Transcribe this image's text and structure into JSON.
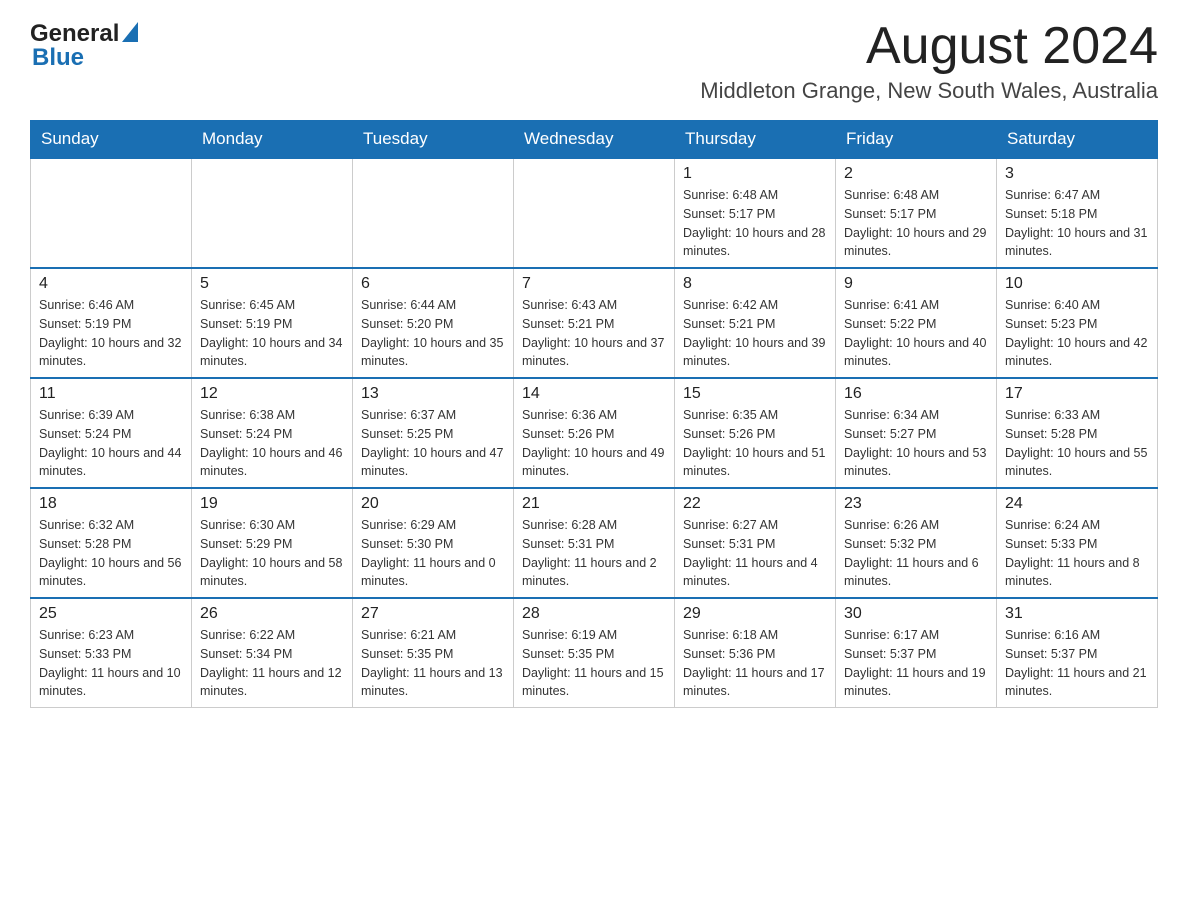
{
  "header": {
    "logo_general": "General",
    "logo_blue": "Blue",
    "month_year": "August 2024",
    "location": "Middleton Grange, New South Wales, Australia"
  },
  "weekdays": [
    "Sunday",
    "Monday",
    "Tuesday",
    "Wednesday",
    "Thursday",
    "Friday",
    "Saturday"
  ],
  "weeks": [
    {
      "days": [
        {
          "date": "",
          "info": ""
        },
        {
          "date": "",
          "info": ""
        },
        {
          "date": "",
          "info": ""
        },
        {
          "date": "",
          "info": ""
        },
        {
          "date": "1",
          "info": "Sunrise: 6:48 AM\nSunset: 5:17 PM\nDaylight: 10 hours and 28 minutes."
        },
        {
          "date": "2",
          "info": "Sunrise: 6:48 AM\nSunset: 5:17 PM\nDaylight: 10 hours and 29 minutes."
        },
        {
          "date": "3",
          "info": "Sunrise: 6:47 AM\nSunset: 5:18 PM\nDaylight: 10 hours and 31 minutes."
        }
      ]
    },
    {
      "days": [
        {
          "date": "4",
          "info": "Sunrise: 6:46 AM\nSunset: 5:19 PM\nDaylight: 10 hours and 32 minutes."
        },
        {
          "date": "5",
          "info": "Sunrise: 6:45 AM\nSunset: 5:19 PM\nDaylight: 10 hours and 34 minutes."
        },
        {
          "date": "6",
          "info": "Sunrise: 6:44 AM\nSunset: 5:20 PM\nDaylight: 10 hours and 35 minutes."
        },
        {
          "date": "7",
          "info": "Sunrise: 6:43 AM\nSunset: 5:21 PM\nDaylight: 10 hours and 37 minutes."
        },
        {
          "date": "8",
          "info": "Sunrise: 6:42 AM\nSunset: 5:21 PM\nDaylight: 10 hours and 39 minutes."
        },
        {
          "date": "9",
          "info": "Sunrise: 6:41 AM\nSunset: 5:22 PM\nDaylight: 10 hours and 40 minutes."
        },
        {
          "date": "10",
          "info": "Sunrise: 6:40 AM\nSunset: 5:23 PM\nDaylight: 10 hours and 42 minutes."
        }
      ]
    },
    {
      "days": [
        {
          "date": "11",
          "info": "Sunrise: 6:39 AM\nSunset: 5:24 PM\nDaylight: 10 hours and 44 minutes."
        },
        {
          "date": "12",
          "info": "Sunrise: 6:38 AM\nSunset: 5:24 PM\nDaylight: 10 hours and 46 minutes."
        },
        {
          "date": "13",
          "info": "Sunrise: 6:37 AM\nSunset: 5:25 PM\nDaylight: 10 hours and 47 minutes."
        },
        {
          "date": "14",
          "info": "Sunrise: 6:36 AM\nSunset: 5:26 PM\nDaylight: 10 hours and 49 minutes."
        },
        {
          "date": "15",
          "info": "Sunrise: 6:35 AM\nSunset: 5:26 PM\nDaylight: 10 hours and 51 minutes."
        },
        {
          "date": "16",
          "info": "Sunrise: 6:34 AM\nSunset: 5:27 PM\nDaylight: 10 hours and 53 minutes."
        },
        {
          "date": "17",
          "info": "Sunrise: 6:33 AM\nSunset: 5:28 PM\nDaylight: 10 hours and 55 minutes."
        }
      ]
    },
    {
      "days": [
        {
          "date": "18",
          "info": "Sunrise: 6:32 AM\nSunset: 5:28 PM\nDaylight: 10 hours and 56 minutes."
        },
        {
          "date": "19",
          "info": "Sunrise: 6:30 AM\nSunset: 5:29 PM\nDaylight: 10 hours and 58 minutes."
        },
        {
          "date": "20",
          "info": "Sunrise: 6:29 AM\nSunset: 5:30 PM\nDaylight: 11 hours and 0 minutes."
        },
        {
          "date": "21",
          "info": "Sunrise: 6:28 AM\nSunset: 5:31 PM\nDaylight: 11 hours and 2 minutes."
        },
        {
          "date": "22",
          "info": "Sunrise: 6:27 AM\nSunset: 5:31 PM\nDaylight: 11 hours and 4 minutes."
        },
        {
          "date": "23",
          "info": "Sunrise: 6:26 AM\nSunset: 5:32 PM\nDaylight: 11 hours and 6 minutes."
        },
        {
          "date": "24",
          "info": "Sunrise: 6:24 AM\nSunset: 5:33 PM\nDaylight: 11 hours and 8 minutes."
        }
      ]
    },
    {
      "days": [
        {
          "date": "25",
          "info": "Sunrise: 6:23 AM\nSunset: 5:33 PM\nDaylight: 11 hours and 10 minutes."
        },
        {
          "date": "26",
          "info": "Sunrise: 6:22 AM\nSunset: 5:34 PM\nDaylight: 11 hours and 12 minutes."
        },
        {
          "date": "27",
          "info": "Sunrise: 6:21 AM\nSunset: 5:35 PM\nDaylight: 11 hours and 13 minutes."
        },
        {
          "date": "28",
          "info": "Sunrise: 6:19 AM\nSunset: 5:35 PM\nDaylight: 11 hours and 15 minutes."
        },
        {
          "date": "29",
          "info": "Sunrise: 6:18 AM\nSunset: 5:36 PM\nDaylight: 11 hours and 17 minutes."
        },
        {
          "date": "30",
          "info": "Sunrise: 6:17 AM\nSunset: 5:37 PM\nDaylight: 11 hours and 19 minutes."
        },
        {
          "date": "31",
          "info": "Sunrise: 6:16 AM\nSunset: 5:37 PM\nDaylight: 11 hours and 21 minutes."
        }
      ]
    }
  ]
}
